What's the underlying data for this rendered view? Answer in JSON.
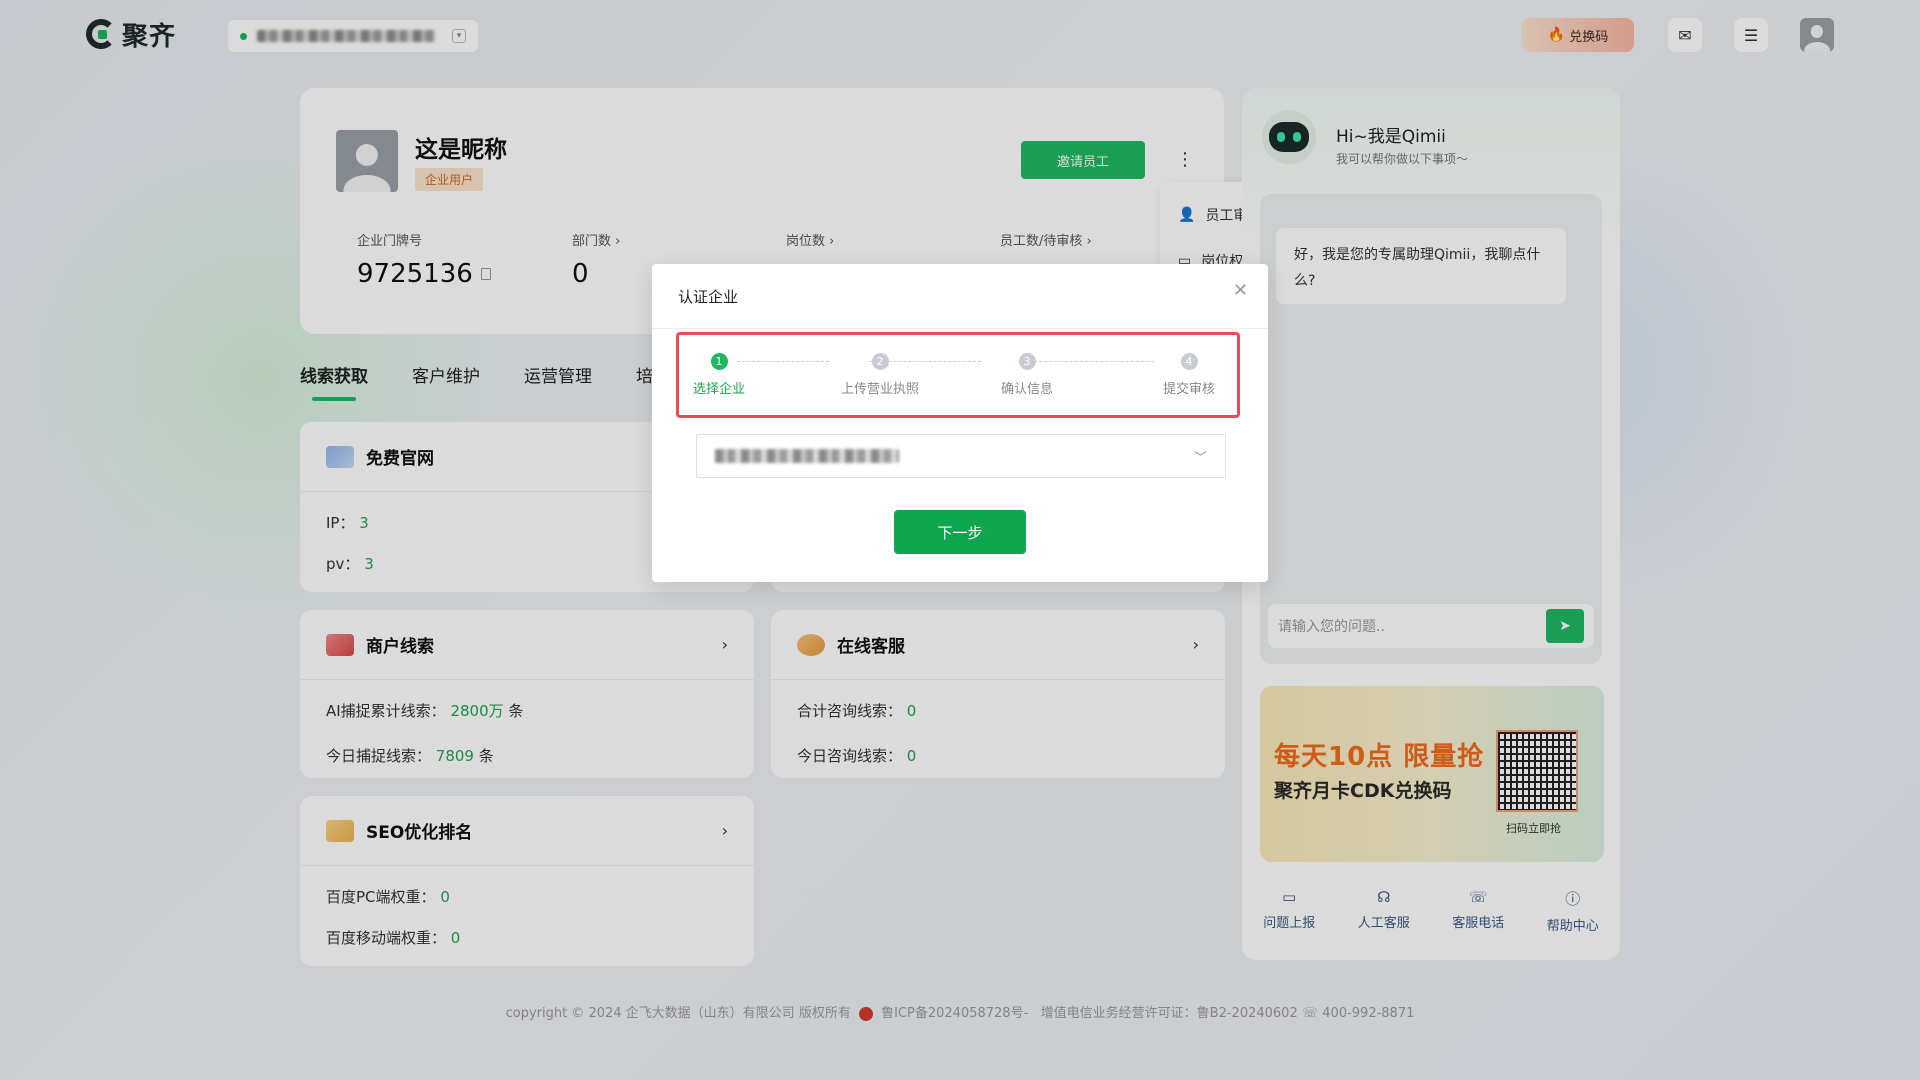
{
  "brand": {
    "name": "聚齐"
  },
  "topbar": {
    "redeem_label": "兑换码",
    "mail_icon": "mail-icon",
    "menu_icon": "menu-icon"
  },
  "profile": {
    "nickname": "这是昵称",
    "badge": "企业用户",
    "invite_label": "邀请员工",
    "stats": [
      {
        "label": "企业门牌号",
        "value": "9725136"
      },
      {
        "label": "部门数",
        "value": "0"
      },
      {
        "label": "岗位数",
        "value": ""
      },
      {
        "label": "员工数/待审核",
        "value": ""
      }
    ]
  },
  "menu": {
    "items": [
      "员工审核",
      "岗位权限"
    ]
  },
  "tabs": [
    "线索获取",
    "客户维护",
    "运营管理",
    "培"
  ],
  "cards": {
    "website": {
      "title": "免费官网",
      "rows": [
        {
          "label": "IP：",
          "value": "3"
        },
        {
          "label": "pv：",
          "value": "3"
        }
      ]
    },
    "merchant": {
      "title": "商户线索",
      "rows": [
        {
          "label": "AI捕捉累计线索：",
          "value": "2800万",
          "unit": "条"
        },
        {
          "label": "今日捕捉线索：",
          "value": "7809",
          "unit": "条"
        }
      ]
    },
    "service": {
      "title": "在线客服",
      "rows": [
        {
          "label": "合计咨询线索：",
          "value": "0"
        },
        {
          "label": "今日咨询线索：",
          "value": "0"
        }
      ]
    },
    "seo": {
      "title": "SEO优化排名",
      "rows": [
        {
          "label": "百度PC端权重：",
          "value": "0"
        },
        {
          "label": "百度移动端权重：",
          "value": "0"
        }
      ]
    }
  },
  "assistant": {
    "greeting": "Hi~我是Qimii",
    "subtitle": "我可以帮你做以下事项～",
    "bubble": "好，我是您的专属助理Qimii，我聊点什么?",
    "input_placeholder": "请输入您的问题..",
    "promo": {
      "line1": "每天10点 限量抢",
      "line2": "聚齐月卡CDK兑换码",
      "qr_caption": "扫码立即抢"
    },
    "quick": [
      "问题上报",
      "人工客服",
      "客服电话",
      "帮助中心"
    ]
  },
  "footer": {
    "copyright": "copyright © 2024 企飞大数据（山东）有限公司 版权所有",
    "icp": "鲁ICP备2024058728号-",
    "license": "增值电信业务经营许可证：鲁B2-20240602",
    "phone": "400-992-8871"
  },
  "modal": {
    "title": "认证企业",
    "steps": [
      "选择企业",
      "上传营业执照",
      "确认信息",
      "提交审核"
    ],
    "step_numbers": [
      "1",
      "2",
      "3",
      "4"
    ],
    "active_step": 1,
    "next_label": "下一步"
  },
  "colors": {
    "primary": "#1fb861",
    "highlight_border": "#e84b5a",
    "promo_orange": "#f06b1a"
  }
}
